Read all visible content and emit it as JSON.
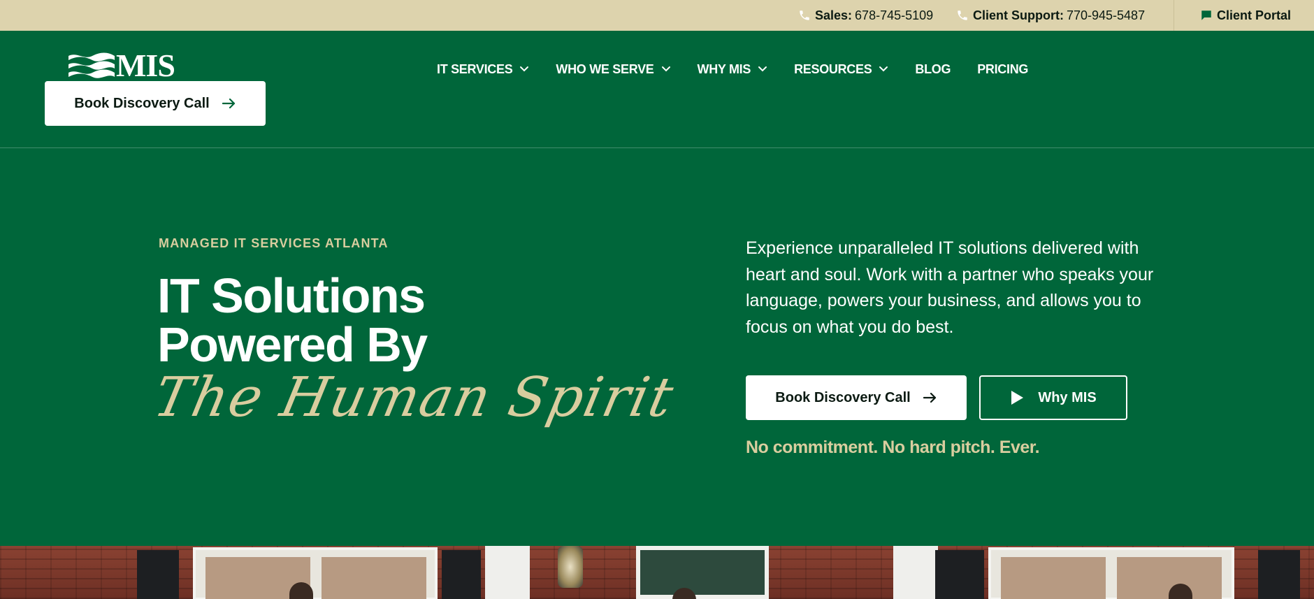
{
  "topbar": {
    "sales_label": "Sales:",
    "sales_phone": "678-745-5109",
    "support_label": "Client Support:",
    "support_phone": "770-945-5487",
    "portal_label": "Client Portal"
  },
  "header": {
    "logo_text": "MIS",
    "cta_label": "Book Discovery Call",
    "nav": [
      {
        "label": "IT SERVICES",
        "dropdown": true
      },
      {
        "label": "WHO WE SERVE",
        "dropdown": true
      },
      {
        "label": "WHY MIS",
        "dropdown": true
      },
      {
        "label": "RESOURCES",
        "dropdown": true
      },
      {
        "label": "BLOG",
        "dropdown": false
      },
      {
        "label": "PRICING",
        "dropdown": false
      }
    ]
  },
  "hero": {
    "eyebrow": "MANAGED IT SERVICES ATLANTA",
    "title_line1": "IT Solutions",
    "title_line2": "Powered By",
    "script_line": "The Human Spirit",
    "lead": "Experience unparalleled IT solutions delivered with heart and soul. Work with a partner who speaks your language, powers your business, and allows you to focus on what you do best.",
    "primary_cta": "Book Discovery Call",
    "secondary_cta": "Why MIS",
    "reassurance": "No commitment. No hard pitch. Ever."
  },
  "colors": {
    "brand_green": "#00663a",
    "topbar_beige": "#ddd3ad",
    "accent_tan": "#d9cd9f",
    "text_dark": "#0b1a12"
  },
  "icons": {
    "phone": "phone-icon",
    "chat": "chat-icon",
    "arrow": "arrow-right-icon",
    "play": "play-icon",
    "chevron": "chevron-down-icon"
  }
}
